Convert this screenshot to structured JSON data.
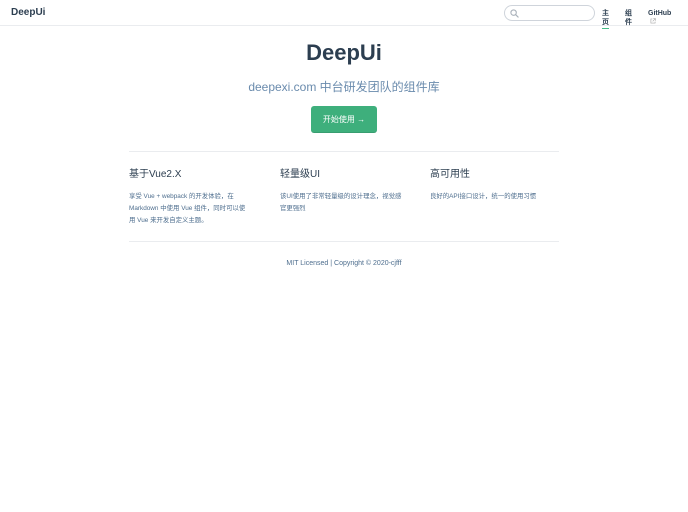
{
  "navbar": {
    "site_name": "DeepUi",
    "search": {
      "placeholder": "",
      "value": ""
    },
    "links": [
      {
        "label": "主页",
        "active": true
      },
      {
        "label": "组件",
        "active": false
      },
      {
        "label": "GitHub",
        "active": false,
        "external": true
      }
    ]
  },
  "hero": {
    "title": "DeepUi",
    "description": "deepexi.com 中台研发团队的组件库",
    "action_label": "开始使用 →"
  },
  "features": [
    {
      "title": "基于Vue2.X",
      "lines": [
        "享受 Vue + webpack 的开发体验，在",
        "Markdown 中使用 Vue 组件，同时可以使",
        "用 Vue 来开发自定义主题。"
      ]
    },
    {
      "title": "轻量级UI",
      "lines": [
        "该UI使用了非常轻量级的设计理念，视觉感",
        "官更强烈"
      ]
    },
    {
      "title": "高可用性",
      "lines": [
        "良好的API接口设计，统一的使用习惯"
      ]
    }
  ],
  "footer": {
    "text": "MIT Licensed | Copyright © 2020-cjfff"
  },
  "colors": {
    "accent": "#3eaf7c",
    "text": "#2c3e50",
    "description": "#6a8bad",
    "border": "#eaecef"
  }
}
